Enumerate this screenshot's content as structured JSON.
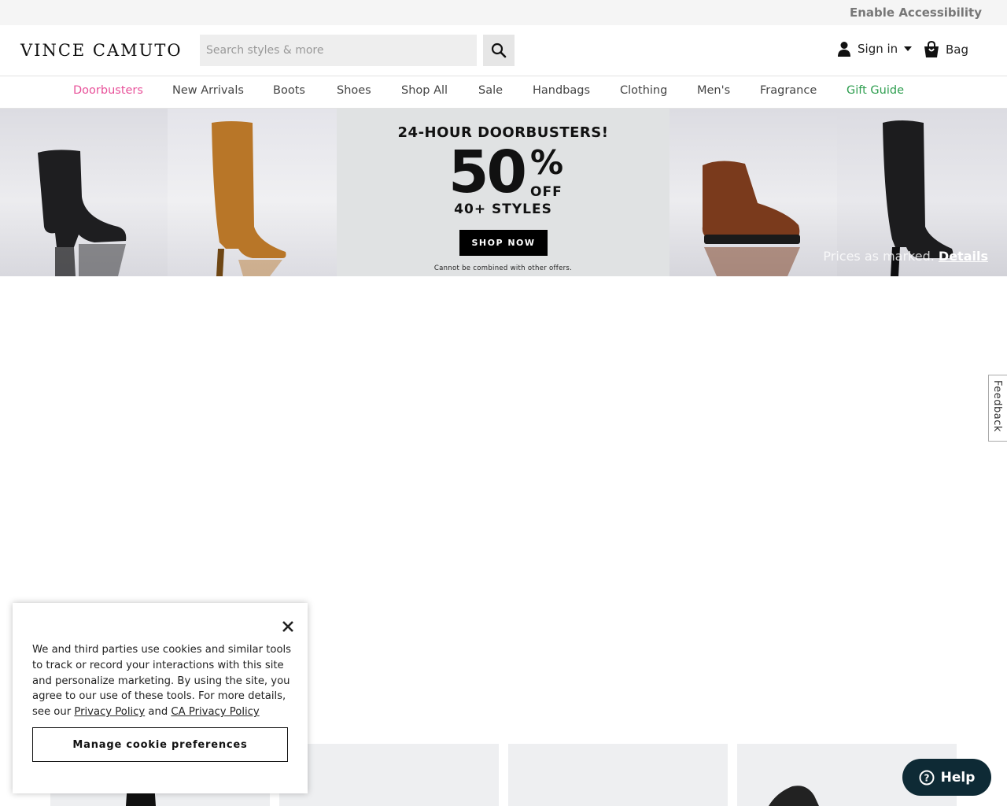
{
  "topbar": {
    "accessibility_label": "Enable Accessibility"
  },
  "header": {
    "logo": "VINCE CAMUTO",
    "search_placeholder": "Search styles & more",
    "signin_label": "Sign in",
    "bag_label": "Bag"
  },
  "nav": [
    {
      "label": "Doorbusters",
      "color": "#e8529a"
    },
    {
      "label": "New Arrivals",
      "color": "#444444"
    },
    {
      "label": "Boots",
      "color": "#444444"
    },
    {
      "label": "Shoes",
      "color": "#444444"
    },
    {
      "label": "Shop All",
      "color": "#444444"
    },
    {
      "label": "Sale",
      "color": "#444444"
    },
    {
      "label": "Handbags",
      "color": "#444444"
    },
    {
      "label": "Clothing",
      "color": "#444444"
    },
    {
      "label": "Men's",
      "color": "#444444"
    },
    {
      "label": "Fragrance",
      "color": "#444444"
    },
    {
      "label": "Gift Guide",
      "color": "#2e9e4f"
    }
  ],
  "hero": {
    "headline": "24-HOUR DOORBUSTERS!",
    "big_number": "50",
    "percent": "%",
    "off": "OFF",
    "styles": "40+ STYLES",
    "cta": "SHOP NOW",
    "fine_print": "Cannot be combined with other offers.",
    "prices_text": "Prices as marked.",
    "details_link": "Details"
  },
  "feedback_label": "Feedback",
  "cookie": {
    "text_before": "We and third parties use cookies and similar tools to track or record your interactions with this site and personalize marketing. By using the site, you agree to our use of these tools. For more details, see our ",
    "privacy_link": "Privacy Policy",
    "and": " and ",
    "ca_link": "CA Privacy Policy",
    "manage_button": "Manage cookie preferences"
  },
  "help_label": "Help",
  "colors": {
    "accent_pink": "#e8529a",
    "accent_green": "#2e9e4f",
    "help_bg": "#0e2a35"
  }
}
